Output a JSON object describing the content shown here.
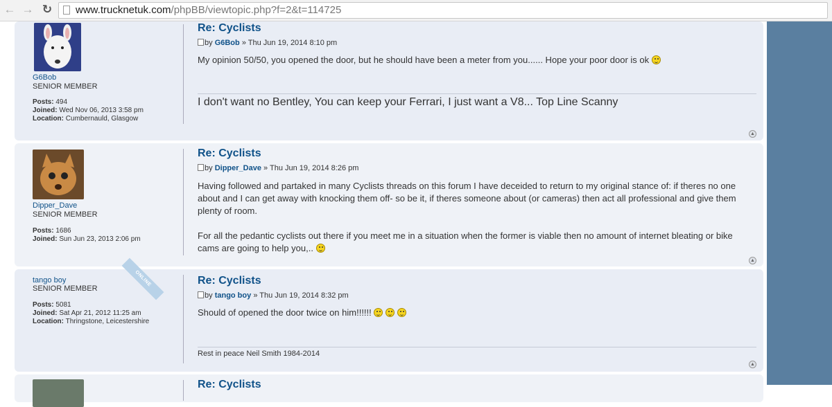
{
  "browser": {
    "url_host": "www.trucknetuk.com",
    "url_path": "/phpBB/viewtopic.php?f=2&t=114725"
  },
  "posts": [
    {
      "title": "Re: Cyclists",
      "by": "by",
      "author": "G6Bob",
      "date": "» Thu Jun 19, 2014 8:10 pm",
      "username": "G6Bob",
      "rank": "SENIOR MEMBER",
      "posts_label": "Posts:",
      "posts_value": "494",
      "joined_label": "Joined:",
      "joined_value": "Wed Nov 06, 2013 3:58 pm",
      "location_label": "Location:",
      "location_value": "Cumbernauld, Glasgow",
      "body": "My opinion 50/50, you opened the door, but he should have been a meter from you...... Hope your poor door is ok",
      "signature": "I don't want no Bentley, You can keep your Ferrari, I just want a V8... Top Line Scanny"
    },
    {
      "title": "Re: Cyclists",
      "by": "by",
      "author": "Dipper_Dave",
      "date": "» Thu Jun 19, 2014 8:26 pm",
      "username": "Dipper_Dave",
      "rank": "SENIOR MEMBER",
      "posts_label": "Posts:",
      "posts_value": "1686",
      "joined_label": "Joined:",
      "joined_value": "Sun Jun 23, 2013 2:06 pm",
      "body_p1": "Having followed and partaked in many Cyclists threads on this forum I have deceided to return to my original stance of: if theres no one about and I can get away with knocking them off- so be it, if theres someone about (or cameras) then act all professional and give them plenty of room.",
      "body_p2": "For all the pedantic cyclists out there if you meet me in a situation when the former is viable then no amount of internet bleating or bike cams are going to help you,.."
    },
    {
      "title": "Re: Cyclists",
      "by": "by",
      "author": "tango boy",
      "date": "» Thu Jun 19, 2014 8:32 pm",
      "username": "tango boy",
      "rank": "SENIOR MEMBER",
      "online": "ONLINE",
      "posts_label": "Posts:",
      "posts_value": "5081",
      "joined_label": "Joined:",
      "joined_value": "Sat Apr 21, 2012 11:25 am",
      "location_label": "Location:",
      "location_value": "Thringstone, Leicestershire",
      "body": "Should of opened the door twice on him!!!!!!",
      "signature": "Rest in peace Neil Smith 1984-2014"
    },
    {
      "title": "Re: Cyclists"
    }
  ],
  "colors": {
    "link": "#105289",
    "post_bg": "#e9edf5",
    "side_strip": "#5a7fa0"
  }
}
